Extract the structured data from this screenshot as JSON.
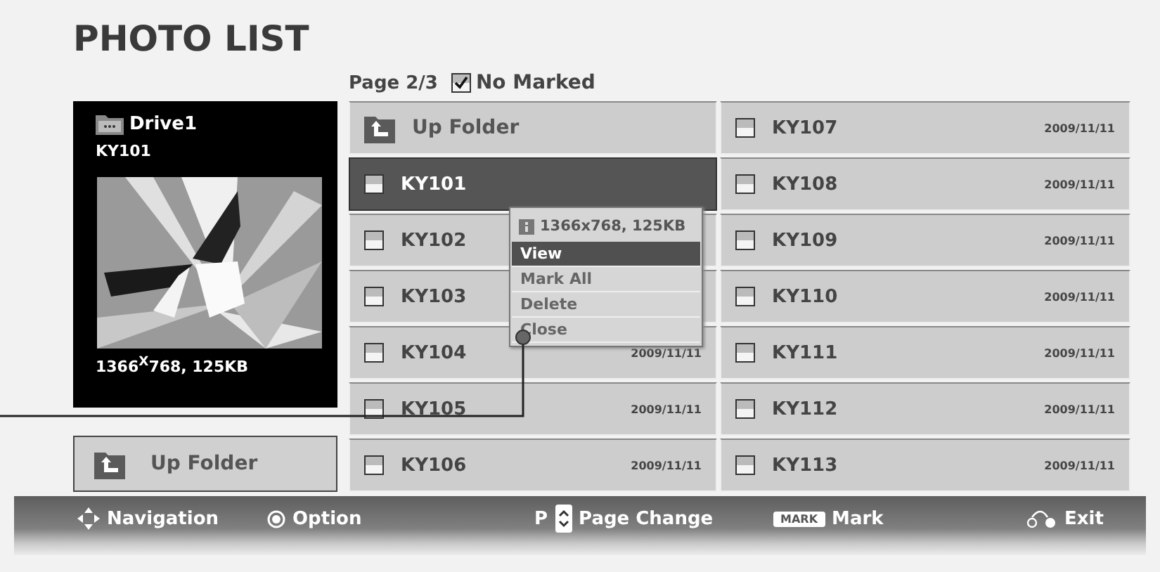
{
  "title": "PHOTO LIST",
  "page": "Page 2/3",
  "marked": {
    "label": "No Marked",
    "checked": true
  },
  "preview": {
    "drive": "Drive1",
    "file": "KY101",
    "info": "1366$^{X}$768, 125KB"
  },
  "up_folder_button": "Up Folder",
  "files": [
    {
      "kind": "folder",
      "label": "Up Folder"
    },
    {
      "kind": "file",
      "name": "KY101",
      "selected": true,
      "checked": false
    },
    {
      "kind": "file",
      "name": "KY102",
      "selected": false,
      "checked": false
    },
    {
      "kind": "file",
      "name": "KY103",
      "selected": false,
      "checked": false
    },
    {
      "kind": "file",
      "name": "KY104",
      "date": "2009/11/11",
      "selected": false,
      "checked": false
    },
    {
      "kind": "file",
      "name": "KY105",
      "date": "2009/11/11",
      "selected": false,
      "checked": false
    },
    {
      "kind": "file",
      "name": "KY106",
      "date": "2009/11/11",
      "selected": false,
      "checked": false
    },
    {
      "kind": "file",
      "name": "KY107",
      "date": "2009/11/11",
      "selected": false,
      "checked": false
    },
    {
      "kind": "file",
      "name": "KY108",
      "date": "2009/11/11",
      "selected": false,
      "checked": false
    },
    {
      "kind": "file",
      "name": "KY109",
      "date": "2009/11/11",
      "selected": false,
      "checked": false
    },
    {
      "kind": "file",
      "name": "KY110",
      "date": "2009/11/11",
      "selected": false,
      "checked": false
    },
    {
      "kind": "file",
      "name": "KY111",
      "date": "2009/11/11",
      "selected": false,
      "checked": false
    },
    {
      "kind": "file",
      "name": "KY112",
      "date": "2009/11/11",
      "selected": false,
      "checked": false
    },
    {
      "kind": "file",
      "name": "KY113",
      "date": "2009/11/11",
      "selected": false,
      "checked": false
    }
  ],
  "menu": {
    "info": "1366x768, 125KB",
    "items": [
      {
        "label": "View",
        "selected": true
      },
      {
        "label": "Mark All",
        "selected": false
      },
      {
        "label": "Delete",
        "selected": false
      },
      {
        "label": "Close",
        "selected": false
      }
    ]
  },
  "footer": [
    {
      "kind": "navigation",
      "label": "Navigation"
    },
    {
      "kind": "option",
      "label": "Option"
    },
    {
      "kind": "page",
      "key": "P",
      "label": "Page Change"
    },
    {
      "kind": "mark",
      "key": "MARK",
      "label": "Mark"
    },
    {
      "kind": "exit",
      "label": "Exit"
    }
  ]
}
